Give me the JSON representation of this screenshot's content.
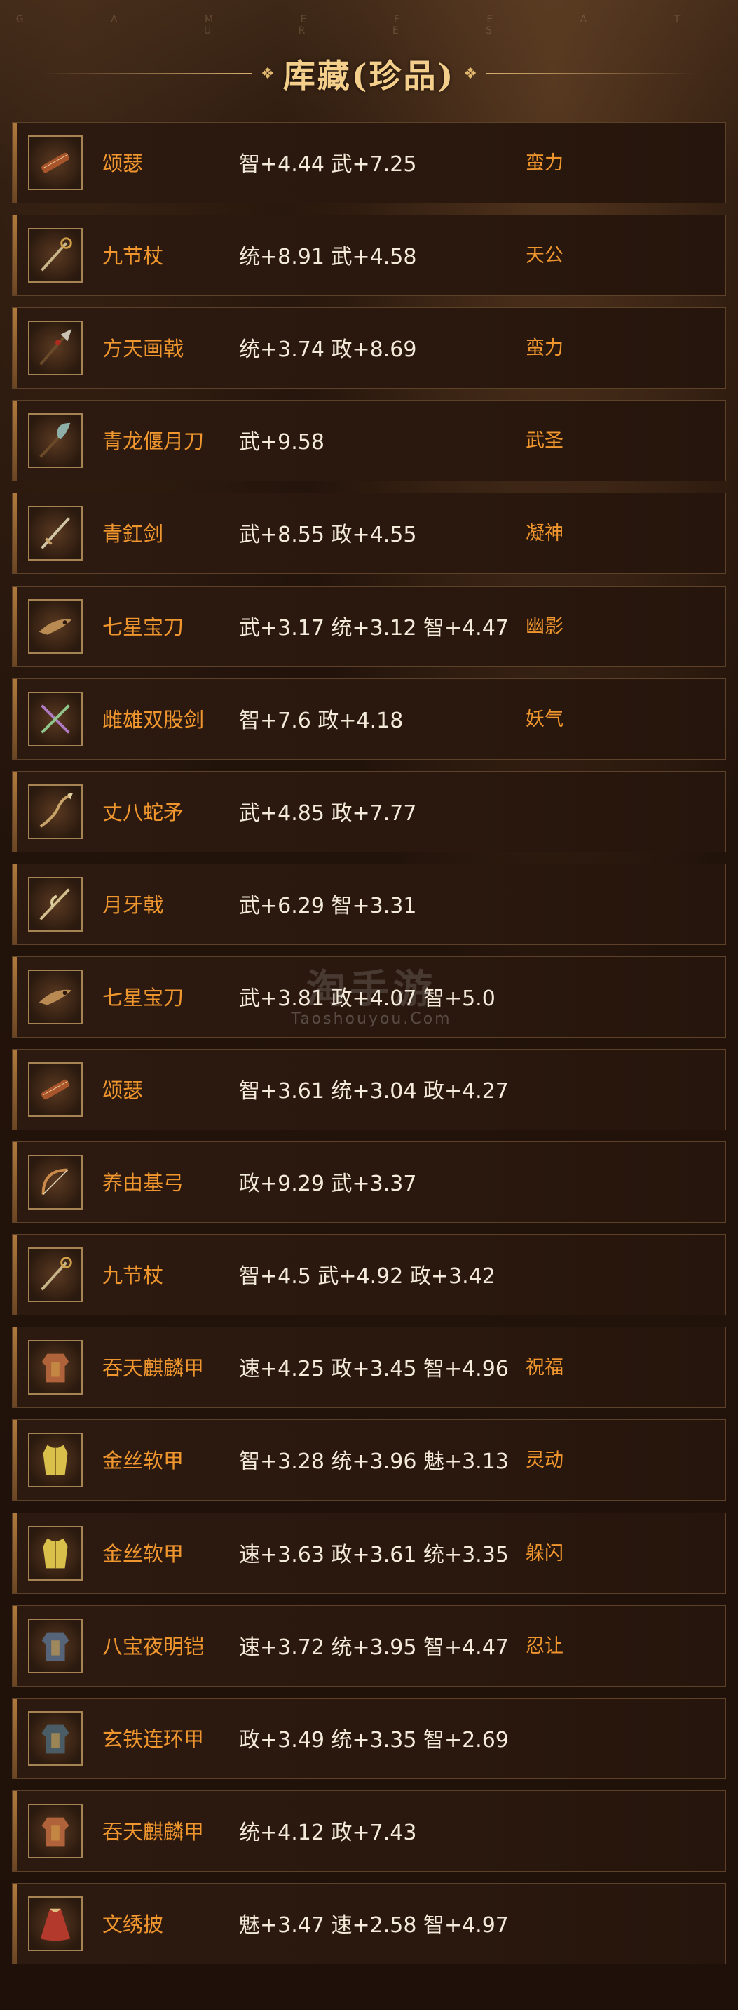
{
  "header": {
    "subtitle": "G A M E   F E A T U R E S",
    "title": "库藏(珍品)"
  },
  "watermark": {
    "main": "淘手游",
    "sub": "Taoshouyou.Com"
  },
  "items": [
    {
      "name": "颂瑟",
      "stats": "智+4.44 武+7.25",
      "trait": "蛮力",
      "icon": "instrument-icon",
      "color": "#a8552c"
    },
    {
      "name": "九节杖",
      "stats": "统+8.91 武+4.58",
      "trait": "天公",
      "icon": "staff-icon",
      "color": "#c9b58a"
    },
    {
      "name": "方天画戟",
      "stats": "统+3.74 政+8.69",
      "trait": "蛮力",
      "icon": "halberd-icon",
      "color": "#c9c2b4"
    },
    {
      "name": "青龙偃月刀",
      "stats": "武+9.58",
      "trait": "武圣",
      "icon": "glaive-icon",
      "color": "#8fb0a8"
    },
    {
      "name": "青釭剑",
      "stats": "武+8.55 政+4.55",
      "trait": "凝神",
      "icon": "sword-icon",
      "color": "#d2c6a6"
    },
    {
      "name": "七星宝刀",
      "stats": "武+3.17 统+3.12 智+4.47",
      "trait": "幽影",
      "icon": "dragon-blade-icon",
      "color": "#b98a52"
    },
    {
      "name": "雌雄双股剑",
      "stats": "智+7.6 政+4.18",
      "trait": "妖气",
      "icon": "twin-swords-icon",
      "color": "#b07bc4"
    },
    {
      "name": "丈八蛇矛",
      "stats": "武+4.85 政+7.77",
      "trait": "",
      "icon": "serpent-spear-icon",
      "color": "#c9a468"
    },
    {
      "name": "月牙戟",
      "stats": "武+6.29 智+3.31",
      "trait": "",
      "icon": "crescent-halberd-icon",
      "color": "#d3c08e"
    },
    {
      "name": "七星宝刀",
      "stats": "武+3.81 政+4.07 智+5.0",
      "trait": "",
      "icon": "dragon-blade-icon",
      "color": "#b98a52"
    },
    {
      "name": "颂瑟",
      "stats": "智+3.61 统+3.04 政+4.27",
      "trait": "",
      "icon": "instrument-icon",
      "color": "#a8552c"
    },
    {
      "name": "养由基弓",
      "stats": "政+9.29 武+3.37",
      "trait": "",
      "icon": "bow-icon",
      "color": "#c98a4a"
    },
    {
      "name": "九节杖",
      "stats": "智+4.5 武+4.92 政+3.42",
      "trait": "",
      "icon": "staff-icon",
      "color": "#c9b58a"
    },
    {
      "name": "吞天麒麟甲",
      "stats": "速+4.25 政+3.45 智+4.96",
      "trait": "祝福",
      "icon": "armor-icon",
      "color": "#b0623a"
    },
    {
      "name": "金丝软甲",
      "stats": "智+3.28 统+3.96 魅+3.13",
      "trait": "灵动",
      "icon": "vest-icon",
      "color": "#d8c04a"
    },
    {
      "name": "金丝软甲",
      "stats": "速+3.63 政+3.61 统+3.35",
      "trait": "躲闪",
      "icon": "vest-icon",
      "color": "#d8c04a"
    },
    {
      "name": "八宝夜明铠",
      "stats": "速+3.72 统+3.95 智+4.47",
      "trait": "忍让",
      "icon": "armor-icon",
      "color": "#56647a"
    },
    {
      "name": "玄铁连环甲",
      "stats": "政+3.49 统+3.35 智+2.69",
      "trait": "",
      "icon": "armor-icon",
      "color": "#4a5d66"
    },
    {
      "name": "吞天麒麟甲",
      "stats": "统+4.12 政+7.43",
      "trait": "",
      "icon": "armor-icon",
      "color": "#b0623a"
    },
    {
      "name": "文绣披",
      "stats": "魅+3.47 速+2.58 智+4.97",
      "trait": "",
      "icon": "cloak-icon",
      "color": "#b3392d"
    }
  ]
}
